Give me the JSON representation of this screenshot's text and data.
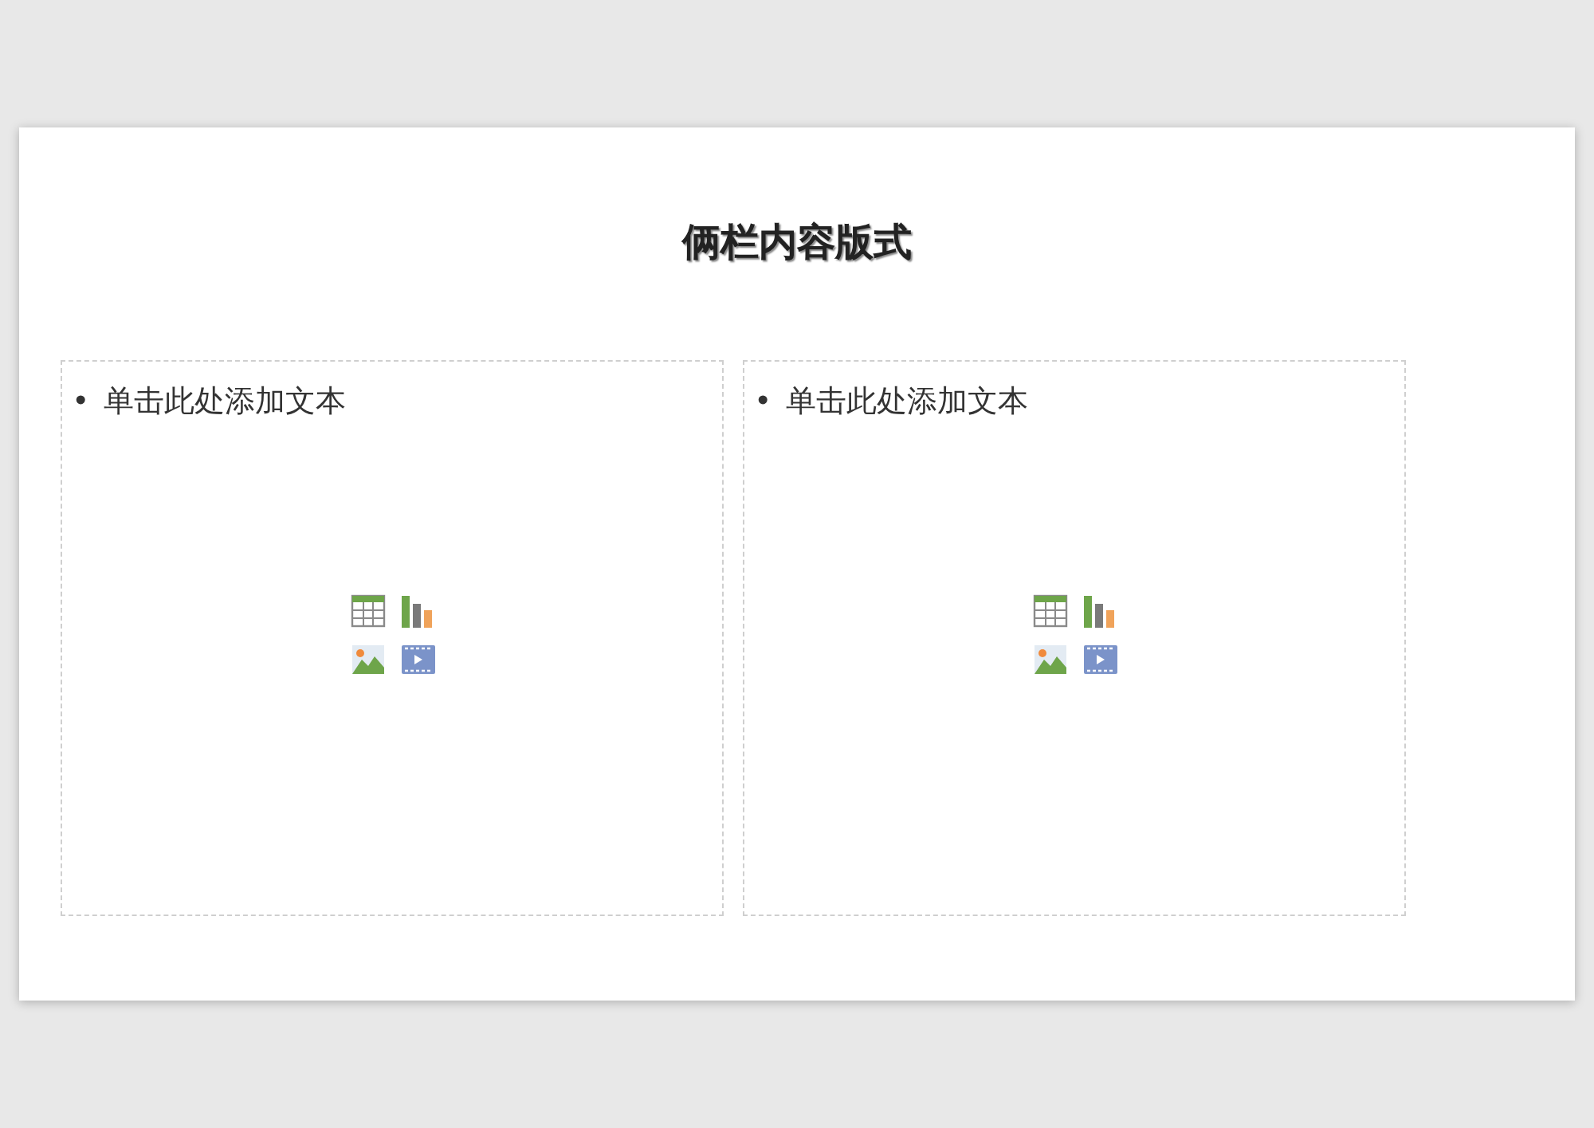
{
  "slide": {
    "title": "俩栏内容版式",
    "placeholders": [
      {
        "bullet": "•",
        "text": "单击此处添加文本"
      },
      {
        "bullet": "•",
        "text": "单击此处添加文本"
      }
    ]
  }
}
